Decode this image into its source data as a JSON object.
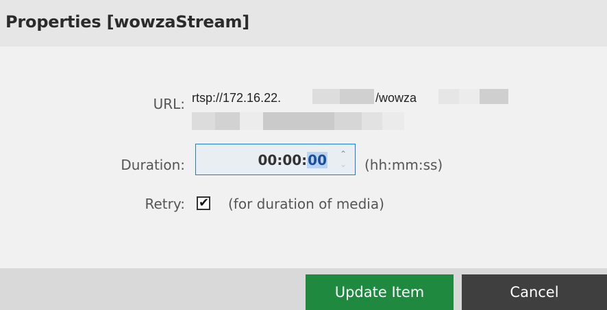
{
  "dialog": {
    "title": "Properties [wowzaStream]"
  },
  "fields": {
    "url_label": "URL:",
    "url_prefix": "rtsp://172.16.22.",
    "url_middle": "/wowza",
    "duration_label": "Duration:",
    "duration_hhmm": "00:00:",
    "duration_ss": "00",
    "duration_hint": "(hh:mm:ss)",
    "retry_label": "Retry:",
    "retry_checked": true,
    "retry_check_glyph": "✔",
    "retry_hint": "(for duration of media)"
  },
  "icons": {
    "spinner_up": "⌃",
    "spinner_down": "⌄"
  },
  "buttons": {
    "update": "Update Item",
    "cancel": "Cancel"
  },
  "colors": {
    "update_button": "#1f8a3f",
    "cancel_button": "#3f3f3f",
    "focus_border": "#1e7ad6"
  }
}
